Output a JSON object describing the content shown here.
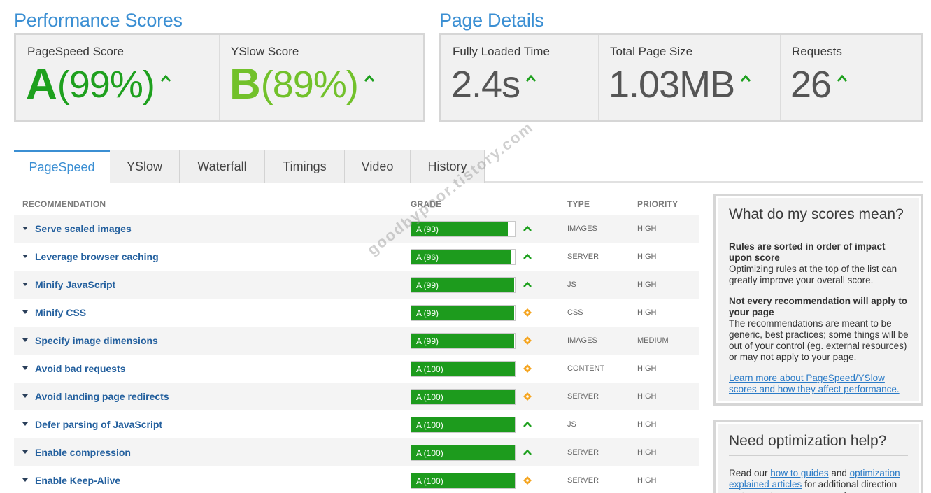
{
  "performance": {
    "title": "Performance Scores",
    "pagespeed": {
      "label": "PageSpeed Score",
      "grade": "A",
      "percent": "(99%)",
      "color": "#1ea01e"
    },
    "yslow": {
      "label": "YSlow Score",
      "grade": "B",
      "percent": "(89%)",
      "color": "#72c12b"
    }
  },
  "details": {
    "title": "Page Details",
    "loaded": {
      "label": "Fully Loaded Time",
      "value": "2.4s"
    },
    "size": {
      "label": "Total Page Size",
      "value": "1.03MB"
    },
    "requests": {
      "label": "Requests",
      "value": "26"
    }
  },
  "tabs": [
    {
      "label": "PageSpeed"
    },
    {
      "label": "YSlow"
    },
    {
      "label": "Waterfall"
    },
    {
      "label": "Timings"
    },
    {
      "label": "Video"
    },
    {
      "label": "History"
    }
  ],
  "table": {
    "headers": {
      "recommendation": "RECOMMENDATION",
      "grade": "GRADE",
      "type": "TYPE",
      "priority": "PRIORITY"
    },
    "rows": [
      {
        "name": "Serve scaled images",
        "grade": "A (93)",
        "score": 93,
        "type": "IMAGES",
        "priority": "HIGH",
        "indicator": "up"
      },
      {
        "name": "Leverage browser caching",
        "grade": "A (96)",
        "score": 96,
        "type": "SERVER",
        "priority": "HIGH",
        "indicator": "up"
      },
      {
        "name": "Minify JavaScript",
        "grade": "A (99)",
        "score": 99,
        "type": "JS",
        "priority": "HIGH",
        "indicator": "up"
      },
      {
        "name": "Minify CSS",
        "grade": "A (99)",
        "score": 99,
        "type": "CSS",
        "priority": "HIGH",
        "indicator": "diamond"
      },
      {
        "name": "Specify image dimensions",
        "grade": "A (99)",
        "score": 99,
        "type": "IMAGES",
        "priority": "MEDIUM",
        "indicator": "diamond"
      },
      {
        "name": "Avoid bad requests",
        "grade": "A (100)",
        "score": 100,
        "type": "CONTENT",
        "priority": "HIGH",
        "indicator": "diamond"
      },
      {
        "name": "Avoid landing page redirects",
        "grade": "A (100)",
        "score": 100,
        "type": "SERVER",
        "priority": "HIGH",
        "indicator": "diamond"
      },
      {
        "name": "Defer parsing of JavaScript",
        "grade": "A (100)",
        "score": 100,
        "type": "JS",
        "priority": "HIGH",
        "indicator": "up"
      },
      {
        "name": "Enable compression",
        "grade": "A (100)",
        "score": 100,
        "type": "SERVER",
        "priority": "HIGH",
        "indicator": "up"
      },
      {
        "name": "Enable Keep-Alive",
        "grade": "A (100)",
        "score": 100,
        "type": "SERVER",
        "priority": "HIGH",
        "indicator": "diamond"
      }
    ]
  },
  "scores_box": {
    "title": "What do my scores mean?",
    "p1_bold": "Rules are sorted in order of impact upon score",
    "p1_text": "Optimizing rules at the top of the list can greatly improve your overall score.",
    "p2_bold": "Not every recommendation will apply to your page",
    "p2_text": "The recommendations are meant to be generic, best practices; some things will be out of your control (eg. external resources) or may not apply to your page.",
    "link": "Learn more about PageSpeed/YSlow scores and how they affect performance."
  },
  "help_box": {
    "title": "Need optimization help?",
    "t1": "Read our ",
    "link1": "how to guides",
    "t2": " and ",
    "link2": "optimization explained articles",
    "t3": " for additional direction on improving your page performance."
  },
  "watermark": "goodbypoor.tistory.com",
  "colors": {
    "accent": "#3b8fd3",
    "grade_green": "#1d9b1d",
    "diamond_orange": "#f5a623",
    "arrow_green": "#1ea01e"
  }
}
